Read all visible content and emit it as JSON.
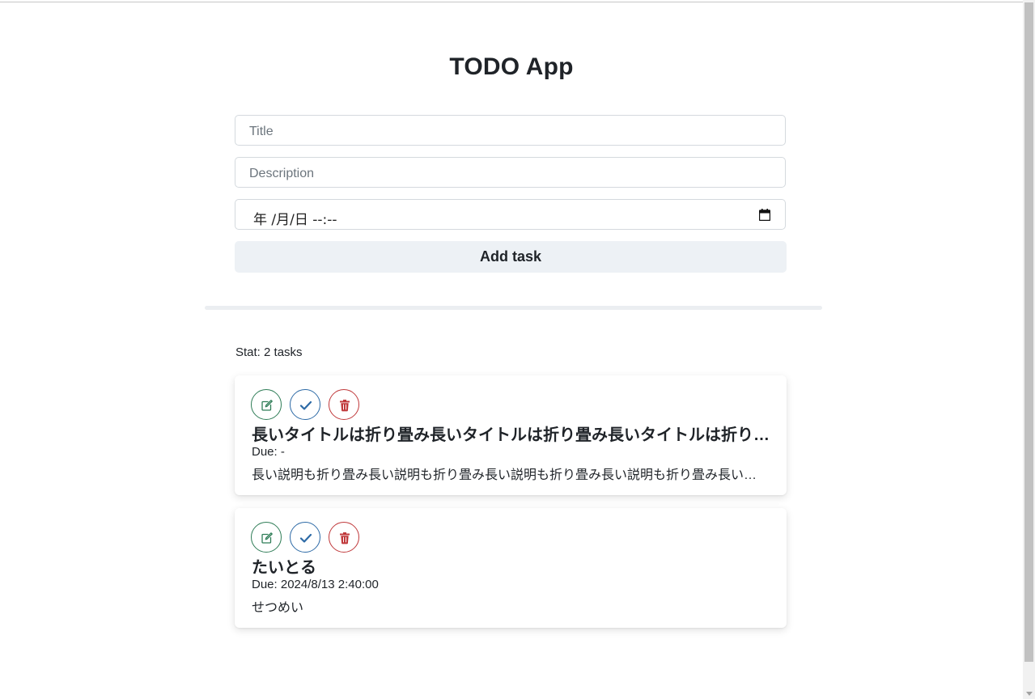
{
  "app": {
    "title": "TODO App"
  },
  "form": {
    "title_placeholder": "Title",
    "description_placeholder": "Description",
    "datetime_display": "年 /月/日 --:--",
    "add_button_label": "Add task"
  },
  "stat": {
    "text": "Stat: 2 tasks"
  },
  "tasks": [
    {
      "title": "長いタイトルは折り畳み長いタイトルは折り畳み長いタイトルは折り畳み長いタイトルは折り畳み",
      "due": "Due: -",
      "description": "長い説明も折り畳み長い説明も折り畳み長い説明も折り畳み長い説明も折り畳み長い説明も折り畳み"
    },
    {
      "title": "たいとる",
      "due": "Due: 2024/8/13 2:40:00",
      "description": "せつめい"
    }
  ],
  "icons": {
    "edit": "edit-icon",
    "complete": "check-icon",
    "delete": "trash-icon",
    "calendar": "calendar-icon"
  },
  "colors": {
    "edit": "#2f7d57",
    "complete": "#2d6aa6",
    "delete": "#c0393b",
    "button_bg": "#edf1f5"
  }
}
